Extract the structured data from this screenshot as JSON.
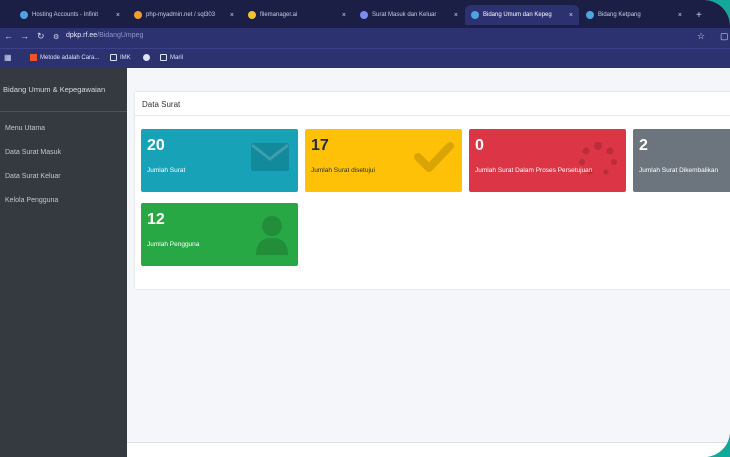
{
  "browser": {
    "tabs": [
      {
        "title": "Hosting Accounts - Infinit",
        "color": "#4fa3e0",
        "active": false
      },
      {
        "title": "php-myadmin.net / sql303",
        "color": "#f0a030",
        "active": false
      },
      {
        "title": "filemanager.ai",
        "color": "#f2c230",
        "active": false
      },
      {
        "title": "Surat Masuk dan Keluar",
        "color": "#7b8cf0",
        "active": false
      },
      {
        "title": "Bidang Umum dan Kepeg",
        "color": "#4fa3e0",
        "active": true
      },
      {
        "title": "Bidang Ketpang",
        "color": "#4fa3e0",
        "active": false
      }
    ],
    "tab_close": "×",
    "new_tab": "+",
    "url_host": "dpkp.rf.ee",
    "url_path": "/BidangUmpeg",
    "bookmarks": [
      {
        "label": "Metode adalah Cara..."
      },
      {
        "label": "IMK"
      },
      {
        "label": ""
      },
      {
        "label": "Maril"
      }
    ]
  },
  "sidebar": {
    "brand": "Bidang Umum & Kepegawaian",
    "items": [
      {
        "label": "Menu Utama"
      },
      {
        "label": "Data Surat Masuk"
      },
      {
        "label": "Data Surat Keluar"
      },
      {
        "label": "Kelola Pengguna"
      }
    ]
  },
  "content": {
    "title": "Data Surat",
    "boxes": [
      {
        "value": "20",
        "label": "Jumlah Surat",
        "color": "#17a2b8",
        "icon": "envelope-icon"
      },
      {
        "value": "17",
        "label": "Jumlah Surat disetujui",
        "color": "#ffc107",
        "icon": "check-icon"
      },
      {
        "value": "0",
        "label": "Jumlah Surat Dalam Proses Persetujuan",
        "color": "#dc3545",
        "icon": "spinner-icon"
      },
      {
        "value": "2",
        "label": "Jumlah Surat Dikembalikan",
        "color": "#6c757d",
        "icon": "undo-icon"
      },
      {
        "value": "12",
        "label": "Jumlah Pengguna",
        "color": "#28a745",
        "icon": "user-icon"
      }
    ]
  }
}
